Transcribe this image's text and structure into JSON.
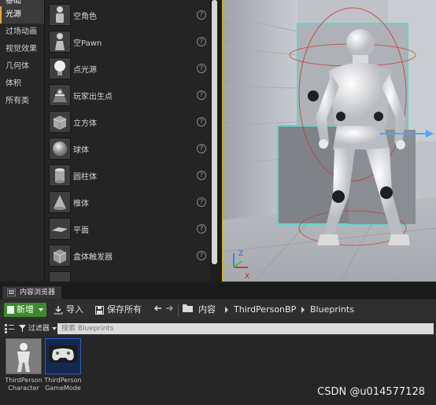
{
  "place_panel": {
    "categories": [
      "基础",
      "光源",
      "过场动画",
      "视觉效果",
      "几何体",
      "体积",
      "所有类"
    ],
    "actors": [
      "空角色",
      "空Pawn",
      "点光源",
      "玩家出生点",
      "立方体",
      "球体",
      "圆柱体",
      "椎体",
      "平面",
      "盒体触发器"
    ],
    "help_glyph": "?"
  },
  "viewport": {
    "axis_z": "Z",
    "axis_x": "X"
  },
  "content_browser": {
    "tab_label": "内容浏览器",
    "toolbar": {
      "add_label": "新增",
      "import_label": "导入",
      "save_all_label": "保存所有"
    },
    "breadcrumb": [
      "内容",
      "ThirdPersonBP",
      "Blueprints"
    ],
    "filter_label": "过滤器",
    "search_placeholder": "搜索 Blueprints",
    "assets": [
      {
        "label": "ThirdPerson\nCharacter"
      },
      {
        "label": "ThirdPerson\nGameMode"
      }
    ]
  },
  "watermark": "CSDN @u014577128",
  "colors": {
    "accent_orange": "#e8a33c",
    "add_button_green": "#3d8a2e",
    "scrollbar_thumb": "#d7d7d7",
    "selection_teal": "#58d8cc",
    "capsule_red": "#c0392b"
  }
}
